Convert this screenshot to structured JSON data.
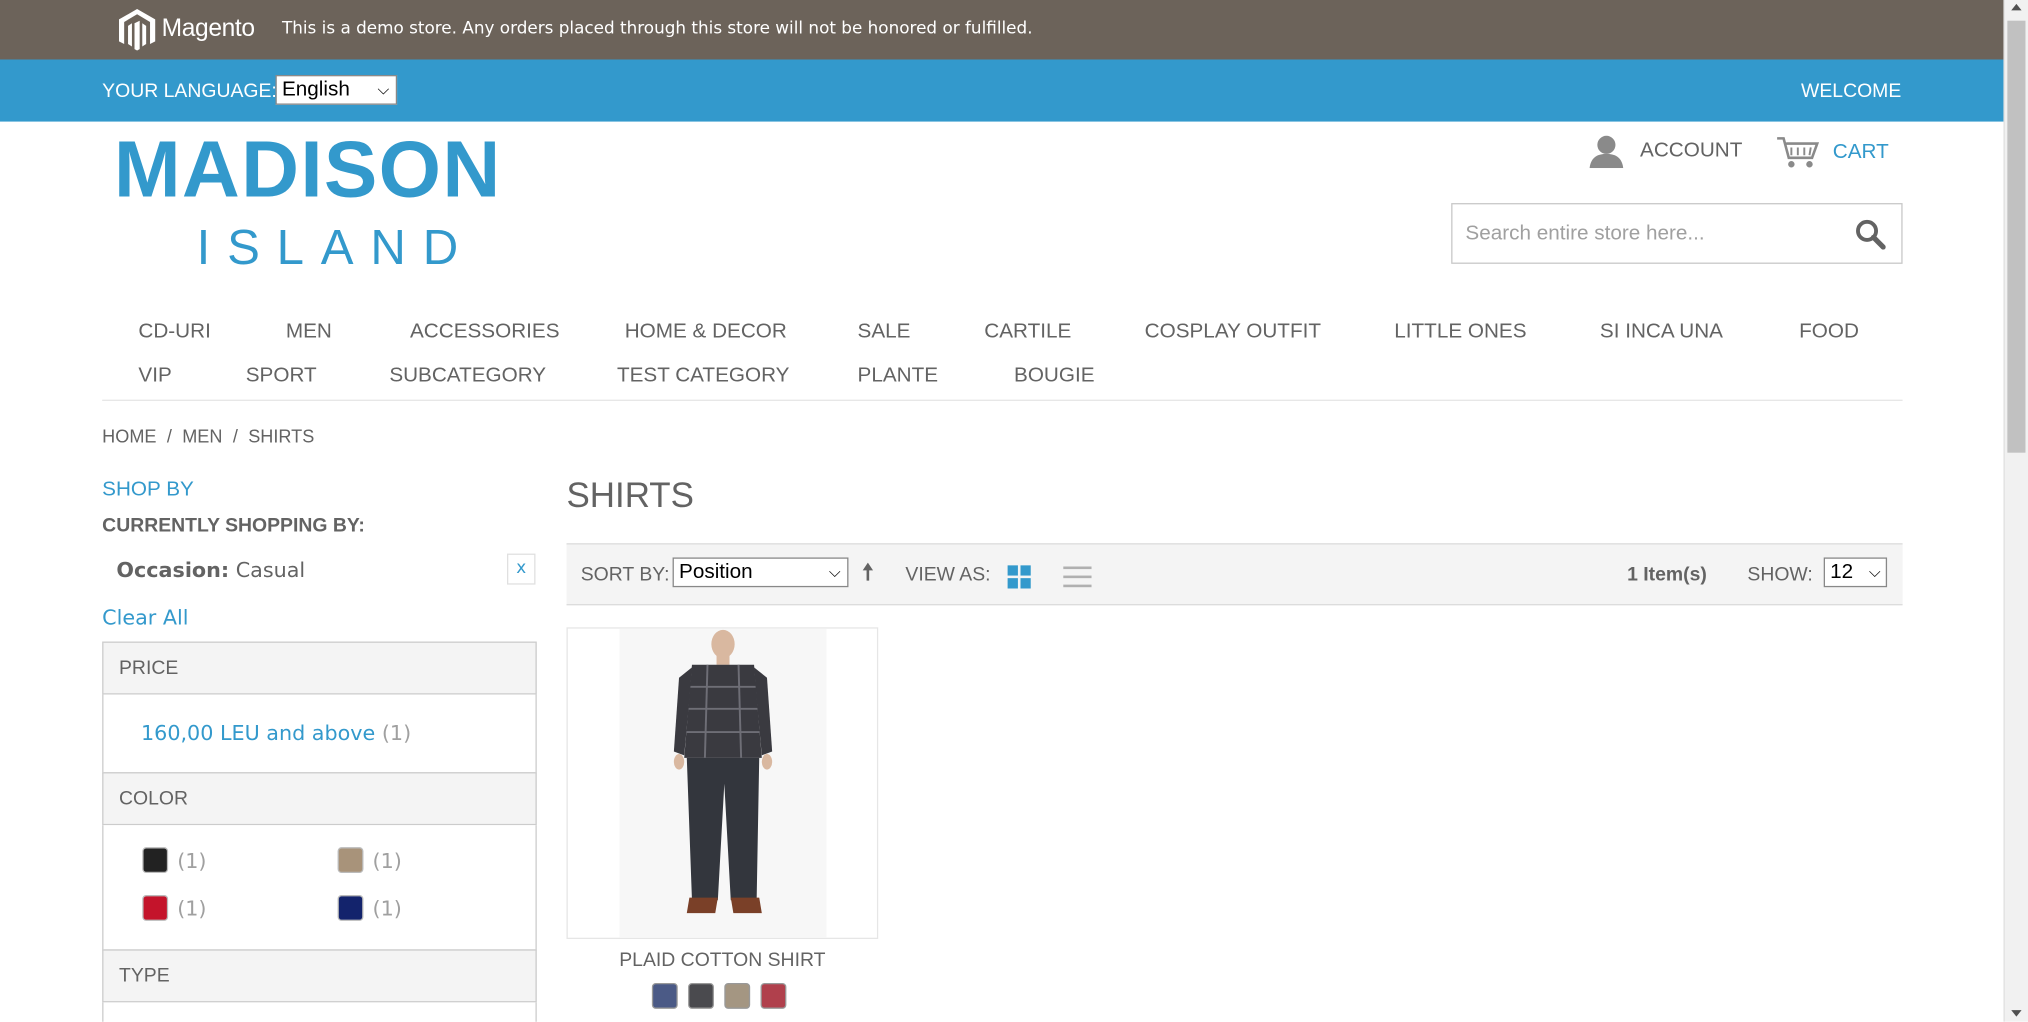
{
  "demo_bar": {
    "logo_text": "Magento",
    "notice": "This is a demo store. Any orders placed through this store will not be honored or fulfilled."
  },
  "lang_bar": {
    "label": "YOUR LANGUAGE:",
    "selected_language": "English",
    "welcome": "WELCOME"
  },
  "brand": {
    "line1": "MADISON",
    "line2": "ISLAND"
  },
  "header": {
    "account_label": "ACCOUNT",
    "cart_label": "CART",
    "search_placeholder": "Search entire store here..."
  },
  "nav": {
    "items": [
      "CD-URI",
      "MEN",
      "ACCESSORIES",
      "HOME & DECOR",
      "SALE",
      "CARTILE",
      "COSPLAY OUTFIT",
      "LITTLE ONES",
      "SI INCA UNA",
      "FOOD",
      "VIP",
      "SPORT",
      "SUBCATEGORY",
      "TEST CATEGORY",
      "PLANTE",
      "BOUGIE"
    ]
  },
  "breadcrumb": [
    "HOME",
    "MEN",
    "SHIRTS"
  ],
  "sidebar": {
    "shop_by": "SHOP BY",
    "currently_shopping_by": "CURRENTLY SHOPPING BY:",
    "filter_name": "Occasion:",
    "filter_value": "Casual",
    "remove_label": "x",
    "clear_all": "Clear All",
    "price_heading": "PRICE",
    "price_option": "160,00 LEU and above",
    "price_count": "(1)",
    "color_heading": "COLOR",
    "colors": [
      {
        "name": "black",
        "hex": "#222222",
        "count": "(1)"
      },
      {
        "name": "taupe",
        "hex": "#a8937a",
        "count": "(1)"
      },
      {
        "name": "red",
        "hex": "#c4142b",
        "count": "(1)"
      },
      {
        "name": "navy",
        "hex": "#13236c",
        "count": "(1)"
      }
    ],
    "type_heading": "TYPE"
  },
  "main": {
    "title": "SHIRTS",
    "sort_label": "SORT BY:",
    "sort_value": "Position",
    "view_label": "VIEW AS:",
    "items_count": "1 Item(s)",
    "show_label": "SHOW:",
    "show_value": "12"
  },
  "product": {
    "name": "PLAID COTTON SHIRT",
    "swatches": [
      {
        "name": "blue-plaid",
        "hex": "#4b5a86"
      },
      {
        "name": "charcoal-plaid",
        "hex": "#4a4a4e"
      },
      {
        "name": "khaki-plaid",
        "hex": "#a49682"
      },
      {
        "name": "red-plaid",
        "hex": "#b0404c"
      }
    ]
  },
  "colors": {
    "accent": "#3399cc",
    "demo_bar": "#6c635a",
    "text": "#636363"
  }
}
